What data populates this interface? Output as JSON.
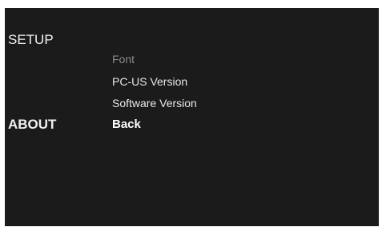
{
  "left_menu": {
    "setup_label": "SETUP",
    "about_label": "ABOUT"
  },
  "submenu": {
    "items": [
      {
        "label": "Font",
        "state": "disabled"
      },
      {
        "label": "PC-US Version",
        "state": "normal"
      },
      {
        "label": "Software Version",
        "state": "normal"
      },
      {
        "label": "Back",
        "state": "selected"
      }
    ]
  },
  "colors": {
    "background": "#1b1b1b",
    "text": "#e8e8e8",
    "disabled_text": "#8a8a8a",
    "selected_text": "#ffffff"
  }
}
